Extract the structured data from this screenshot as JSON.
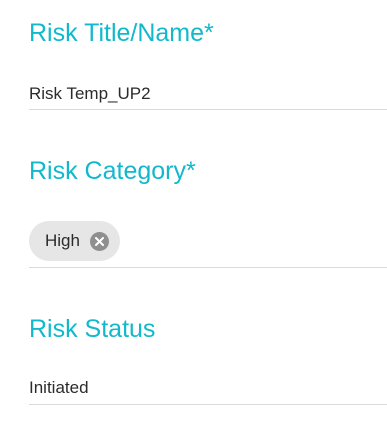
{
  "form": {
    "title_field": {
      "label": "Risk Title/Name*",
      "value": "Risk Temp_UP2"
    },
    "category_field": {
      "label": "Risk Category*",
      "selected_chips": [
        {
          "label": "High",
          "remove_icon": "close-circle-icon"
        }
      ]
    },
    "status_field": {
      "label": "Risk Status",
      "value": "Initiated"
    }
  },
  "colors": {
    "label_accent": "#12b8cc",
    "chip_background": "#e6e6e6",
    "chip_remove_icon": "#8f8f8f",
    "underline": "#d9d9d9",
    "value_text": "#2b2b2b"
  }
}
